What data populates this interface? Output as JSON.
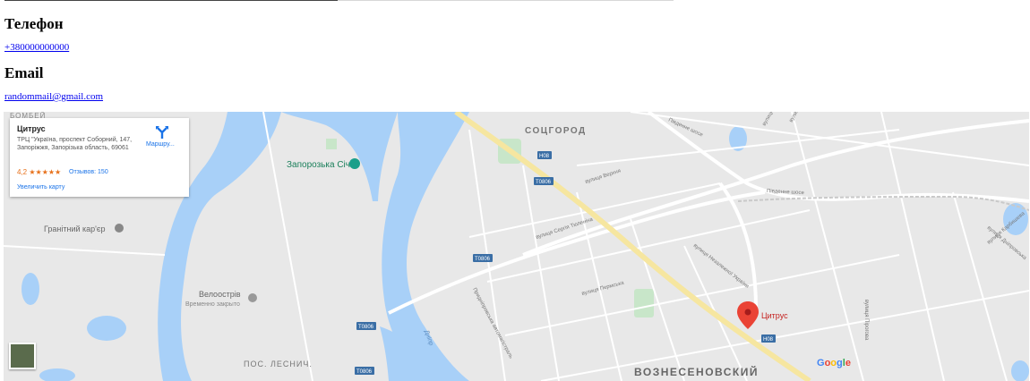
{
  "contacts": {
    "phone_heading": "Телефон",
    "phone_value": "+380000000000",
    "email_heading": "Email",
    "email_value": "randommail@gmail.com"
  },
  "map": {
    "place_card": {
      "title": "Цитрус",
      "address": "ТРЦ \"Україна, проспект Соборний, 147, Запоріжжя, Запорізька область, 69061",
      "rating": "4,2",
      "stars": "★★★★★",
      "reviews": "Отзывов: 150",
      "enlarge": "Увеличить карту",
      "directions": "Маршру..."
    },
    "labels": {
      "bombey": "БОМБЕЙ",
      "sotsgorod": "СОЦГОРОД",
      "zaporozka_sich": "Запорозька Січ",
      "granite_quarry": "Гранітний кар'єр",
      "velo_island": "Велоострів",
      "temp_closed": "Временно закрыто",
      "les_nich": "ПОС. ЛЕСНИЧ.",
      "voznesenovsky": "ВОЗНЕСЕНОВСКИЙ",
      "dnipro": "Дніпр",
      "vulytsia_verkhnia": "вулиця Верхня",
      "vulytsia_tiulenina": "вулиця Сергія Тюленіна",
      "pivdenne_shose1": "Південне шосе",
      "pivdenne_shose2": "Південне шосе",
      "vulytsia_nezalezhnoi": "вулиця Незалежної України",
      "vulytsia_permska": "вулиця Пермська",
      "prydniprovska": "Придніпровська автомагістраль",
      "vulytsia_zabolotnoho": "вулиця Заболотного",
      "vulytsia_kalynova": "вулиця Калинова",
      "vulytsia_pivn": "вулиця Пірогова",
      "vulytsia_karbysheva": "вулиця Карбишева",
      "vulytsia_dniprova": "вулиця Дніпровська",
      "road_h08_1": "Н08",
      "road_h08_2": "Н08",
      "road_t0806_1": "Т0806",
      "road_t0806_2": "Т0806",
      "road_t0806_3": "Т0806",
      "road_t0806_4": "Т0806",
      "marker_label": "Цитрус"
    },
    "attribution": "Google"
  },
  "colors": {
    "water": "#a8d0f8",
    "land": "#e8e8e8",
    "road": "#ffffff",
    "highway": "#f6e6a0",
    "park": "#c8e6c9",
    "marker": "#ea4335",
    "link": "#0000ee"
  }
}
